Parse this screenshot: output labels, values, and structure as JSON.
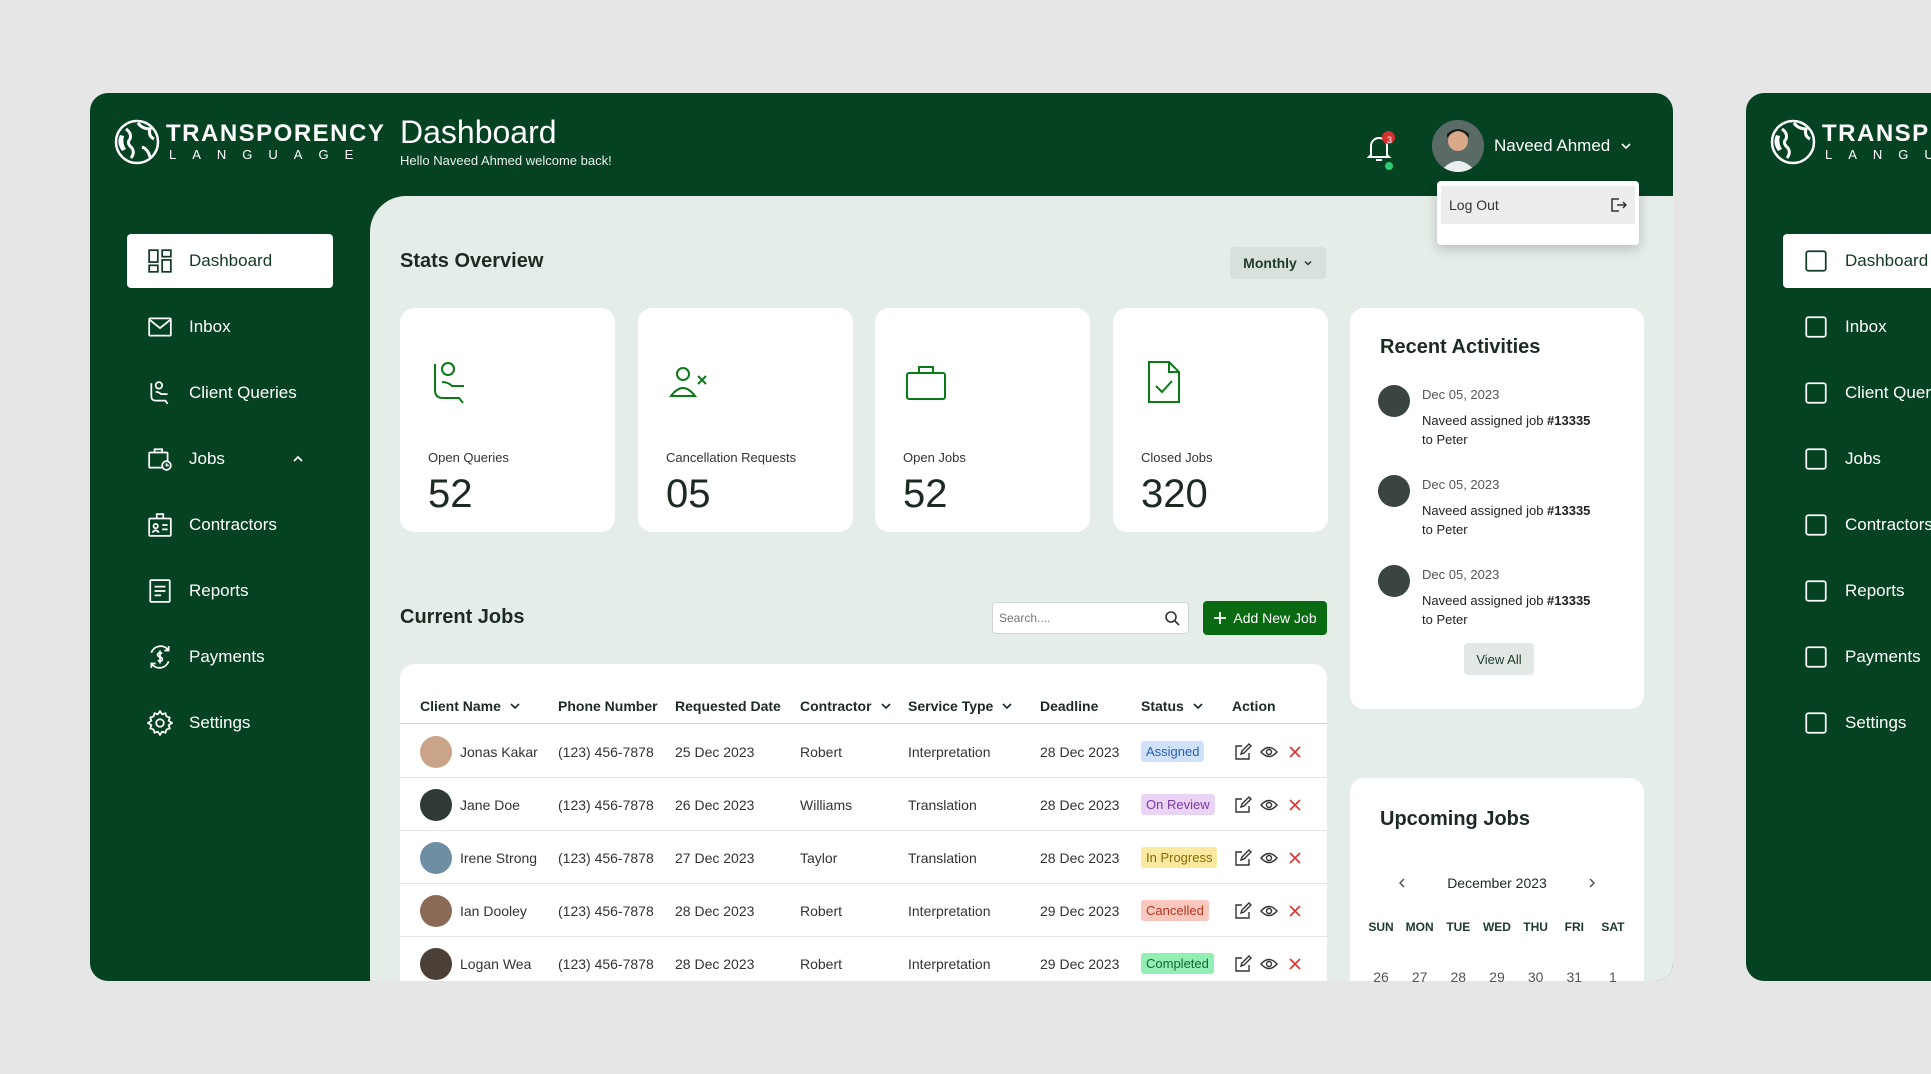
{
  "app": {
    "logo_line1": "TRANSPORENCY",
    "logo_line2": "LANGUAGE"
  },
  "header": {
    "title": "Dashboard",
    "subtitle": "Hello Naveed Ahmed welcome back!",
    "notifications": "3",
    "user_name": "Naveed Ahmed"
  },
  "user_menu": {
    "logout": "Log Out"
  },
  "sidebar": {
    "items": [
      {
        "label": "Dashboard"
      },
      {
        "label": "Inbox"
      },
      {
        "label": "Client Queries"
      },
      {
        "label": "Jobs"
      },
      {
        "label": "Contractors"
      },
      {
        "label": "Reports"
      },
      {
        "label": "Payments"
      },
      {
        "label": "Settings"
      }
    ]
  },
  "second_window": {
    "logo_line1": "TRANSP",
    "logo_line2": "LANGU",
    "items": [
      "Dashboard",
      "Inbox",
      "Client Quer",
      "Jobs",
      "Contractors",
      "Reports",
      "Payments",
      "Settings"
    ]
  },
  "stats": {
    "title": "Stats Overview",
    "period": "Monthly",
    "cards": [
      {
        "label": "Open Queries",
        "value": "52"
      },
      {
        "label": "Cancellation Requests",
        "value": "05"
      },
      {
        "label": "Open Jobs",
        "value": "52"
      },
      {
        "label": "Closed Jobs",
        "value": "320"
      }
    ]
  },
  "jobs": {
    "title": "Current Jobs",
    "search_placeholder": "Search....",
    "add_button": "Add New Job",
    "columns": [
      "Client Name",
      "Phone Number",
      "Requested Date",
      "Contractor",
      "Service Type",
      "Deadline",
      "Status",
      "Action"
    ],
    "rows": [
      {
        "client": "Jonas Kakar",
        "phone": "(123) 456-7878",
        "requested": "25 Dec 2023",
        "contractor": "Robert",
        "service": "Interpretation",
        "deadline": "28 Dec 2023",
        "status": "Assigned"
      },
      {
        "client": "Jane Doe",
        "phone": "(123) 456-7878",
        "requested": "26 Dec 2023",
        "contractor": "Williams",
        "service": "Translation",
        "deadline": "28 Dec 2023",
        "status": "On Review"
      },
      {
        "client": "Irene Strong",
        "phone": "(123) 456-7878",
        "requested": "27 Dec 2023",
        "contractor": "Taylor",
        "service": "Translation",
        "deadline": "28 Dec 2023",
        "status": "In Progress"
      },
      {
        "client": "Ian Dooley",
        "phone": "(123) 456-7878",
        "requested": "28 Dec 2023",
        "contractor": "Robert",
        "service": "Interpretation",
        "deadline": "29 Dec 2023",
        "status": "Cancelled"
      },
      {
        "client": "Logan Wea",
        "phone": "(123) 456-7878",
        "requested": "28 Dec 2023",
        "contractor": "Robert",
        "service": "Interpretation",
        "deadline": "29 Dec 2023",
        "status": "Completed"
      }
    ]
  },
  "status_colors": {
    "Assigned": {
      "bg": "#cfe1fb",
      "fg": "#2b5fad"
    },
    "On Review": {
      "bg": "#e9d4f5",
      "fg": "#7b3aa0"
    },
    "In Progress": {
      "bg": "#fbe9a0",
      "fg": "#8a6b00"
    },
    "Cancelled": {
      "bg": "#f9c7bd",
      "fg": "#b1361f"
    },
    "Completed": {
      "bg": "#93eeb4",
      "fg": "#146a34"
    }
  },
  "recent": {
    "title": "Recent Activities",
    "items": [
      {
        "date": "Dec 05, 2023",
        "text_prefix": "Naveed assigned job ",
        "job": "#13335",
        "text_suffix": "to Peter"
      },
      {
        "date": "Dec 05, 2023",
        "text_prefix": "Naveed assigned job ",
        "job": "#13335",
        "text_suffix": "to Peter"
      },
      {
        "date": "Dec 05, 2023",
        "text_prefix": "Naveed assigned job ",
        "job": "#13335",
        "text_suffix": "to Peter"
      }
    ],
    "view_all": "View All"
  },
  "upcoming": {
    "title": "Upcoming Jobs",
    "month": "December 2023",
    "days": [
      "SUN",
      "MON",
      "TUE",
      "WED",
      "THU",
      "FRI",
      "SAT"
    ],
    "dates": [
      "26",
      "27",
      "28",
      "29",
      "30",
      "31",
      "1"
    ]
  },
  "colors": {
    "primary": "#054221",
    "accent": "#0a6a12",
    "background": "#e5ede8"
  }
}
